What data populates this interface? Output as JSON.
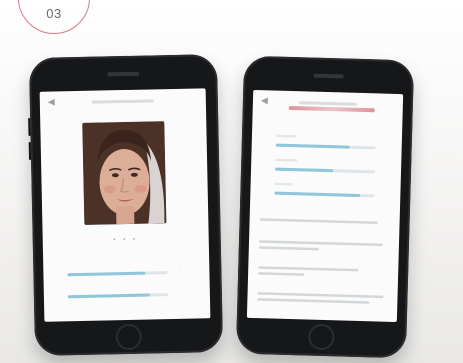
{
  "step": {
    "number": "03"
  },
  "phone_left": {
    "screen": {
      "title": "",
      "subtitle": "",
      "pager_dots": "• • •",
      "metrics": [
        {
          "label": "",
          "level": 0.78
        },
        {
          "label": "",
          "level": 0.82
        }
      ]
    }
  },
  "phone_right": {
    "screen": {
      "title": "",
      "subtitle": "",
      "metrics": [
        {
          "label": "",
          "level": 0.74
        },
        {
          "label": "",
          "level": 0.58
        },
        {
          "label": "",
          "level": 0.86
        }
      ],
      "paragraphs": [
        "",
        "",
        "",
        ""
      ]
    }
  },
  "colors": {
    "accent": "#d87a86",
    "meter": "#8fc6da",
    "phone_body": "#161719"
  }
}
